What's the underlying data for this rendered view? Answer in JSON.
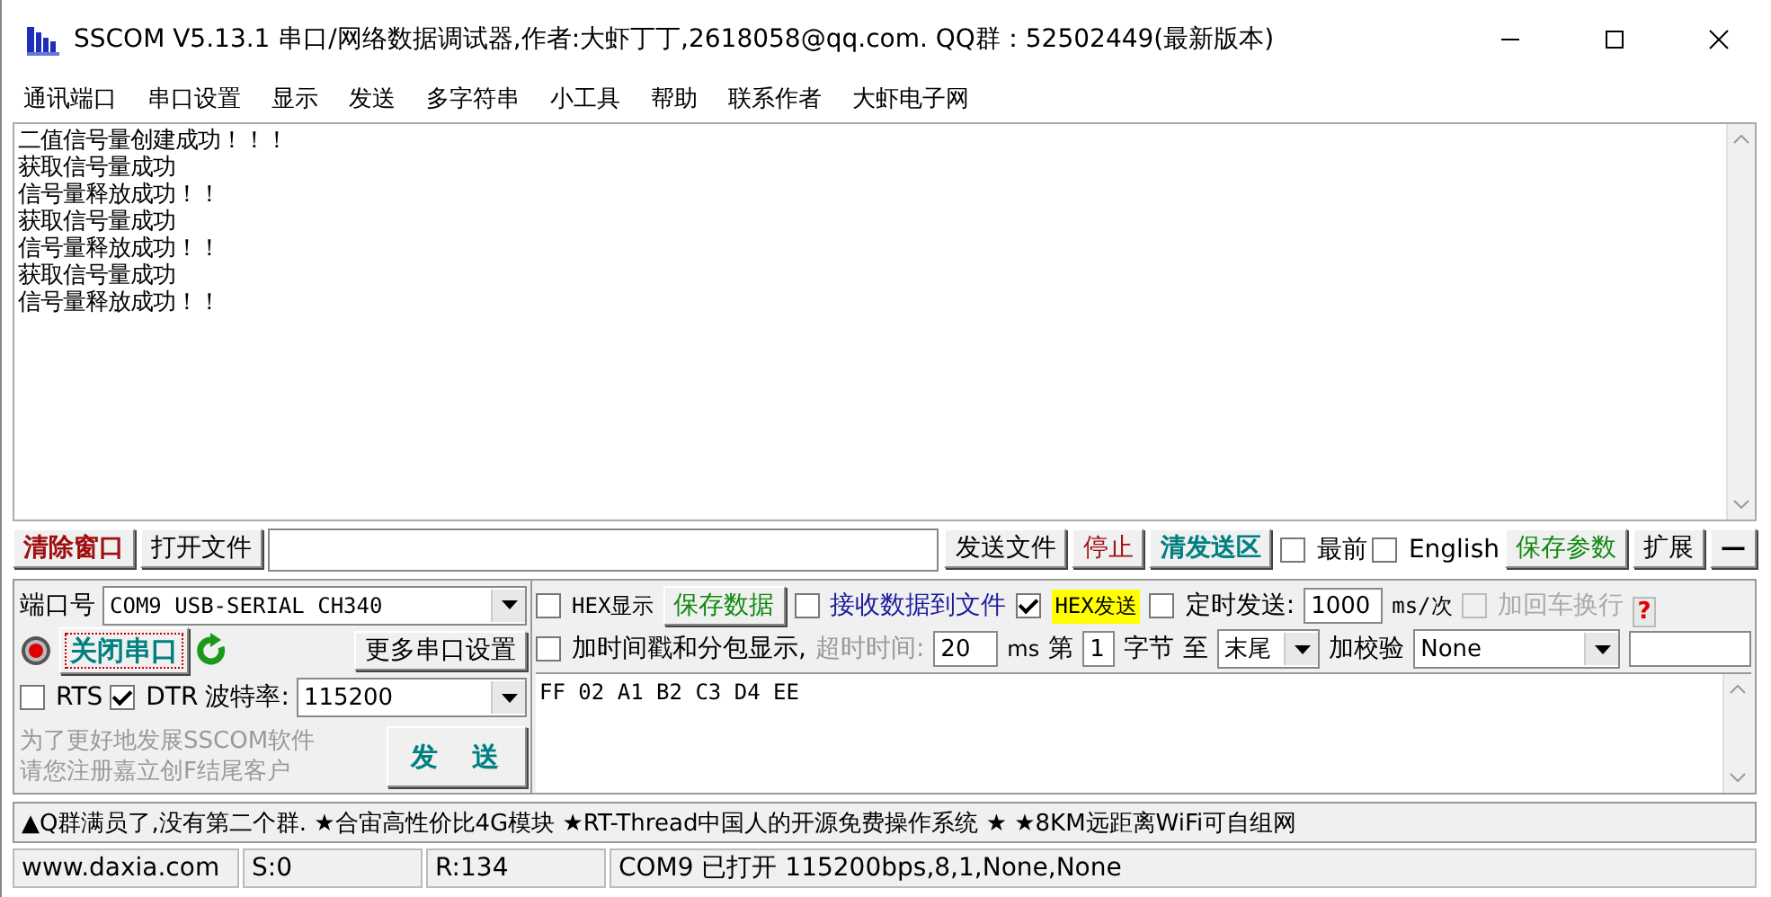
{
  "window": {
    "title": "SSCOM V5.13.1 串口/网络数据调试器,作者:大虾丁丁,2618058@qq.com. QQ群：52502449(最新版本)"
  },
  "menu": [
    "通讯端口",
    "串口设置",
    "显示",
    "发送",
    "多字符串",
    "小工具",
    "帮助",
    "联系作者",
    "大虾电子网"
  ],
  "receive": {
    "lines": [
      "二值信号量创建成功！！！",
      "获取信号量成功",
      "信号量释放成功！！",
      "获取信号量成功",
      "信号量释放成功！！",
      "获取信号量成功",
      "信号量释放成功！！"
    ]
  },
  "toolbar": {
    "clear_button": "清除窗口",
    "open_file_button": "打开文件",
    "send_file_button": "发送文件",
    "stop_button": "停止",
    "clear_send_button": "清发送区",
    "topmost": {
      "label": "最前",
      "checked": false
    },
    "english": {
      "label": "English",
      "checked": false
    },
    "save_params_button": "保存参数",
    "expand_button": "扩展",
    "collapse_button": "—"
  },
  "port": {
    "port_label": "端口号",
    "port_value": "COM9 USB-SERIAL CH340",
    "open": true,
    "close_port_button": "关闭串口",
    "more_settings_button": "更多串口设置",
    "rts": {
      "label": "RTS",
      "checked": false
    },
    "dtr": {
      "label": "DTR",
      "checked": true
    },
    "baud_label": "波特率:",
    "baud_value": "115200",
    "promo": [
      "为了更好地发展SSCOM软件",
      "请您注册嘉立创F结尾客户"
    ],
    "send_button": "发　送"
  },
  "options": {
    "hex_display": {
      "label": "HEX显示",
      "checked": false
    },
    "save_data_button": "保存数据",
    "receive_to_file": {
      "label": "接收数据到文件",
      "checked": false
    },
    "hex_send": {
      "label": "HEX发送",
      "checked": true
    },
    "timed_send": {
      "label": "定时发送:",
      "checked": false
    },
    "interval": "1000",
    "interval_unit": "ms/次",
    "add_crlf": {
      "label": "加回车换行",
      "checked": false,
      "disabled": true
    },
    "help": "?",
    "timestamp": {
      "label": "加时间戳和分包显示,",
      "checked": false
    },
    "timeout_label": "超时时间:",
    "timeout": "20",
    "timeout_unit": "ms",
    "from_label": "第",
    "from": "1",
    "byte_label": "字节",
    "to_label": "至",
    "to_value": "末尾",
    "checksum_label": "加校验",
    "checksum_value": "None"
  },
  "send_text": "FF 02 A1 B2 C3 D4 EE",
  "ticker": "▲Q群满员了,没有第二个群. ★合宙高性价比4G模块 ★RT-Thread中国人的开源免费操作系统 ★ ★8KM远距离WiFi可自组网",
  "status_bar": [
    "www.daxia.com",
    "S:0",
    "R:134",
    "COM9 已打开  115200bps,8,1,None,None"
  ]
}
